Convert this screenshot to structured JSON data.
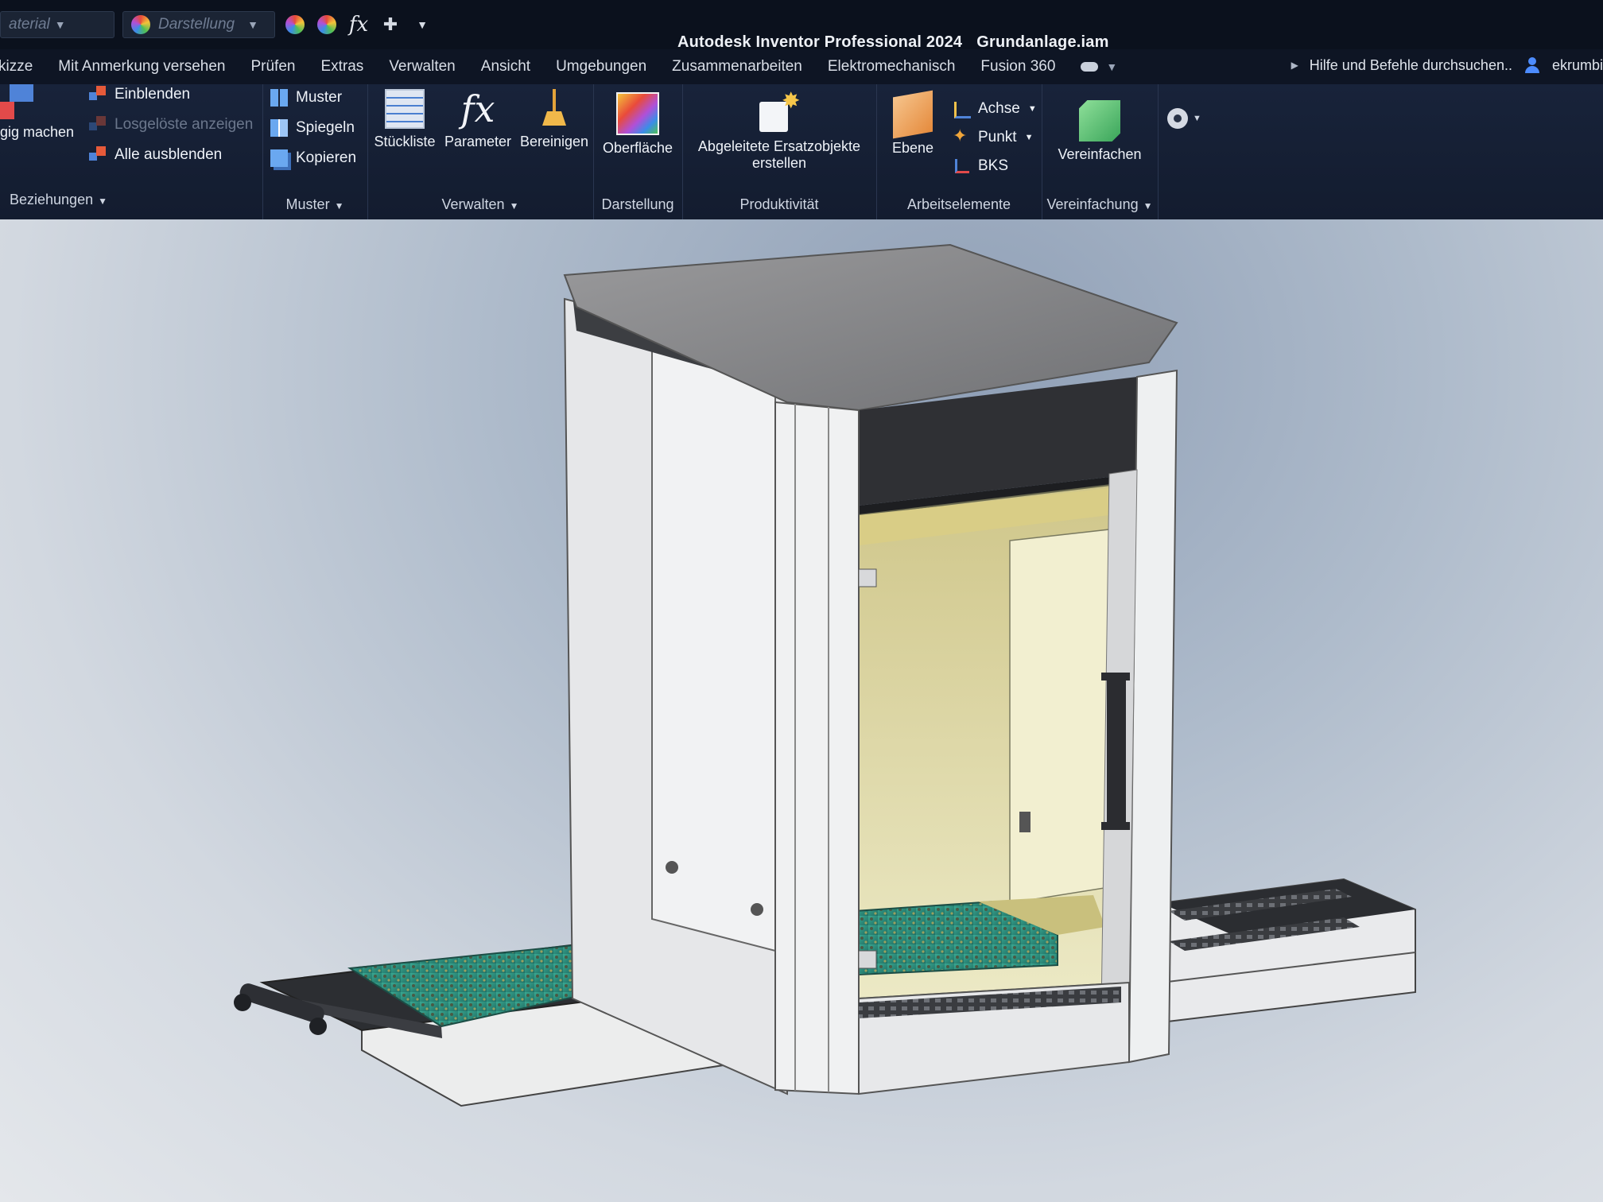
{
  "quick_access": {
    "material_placeholder": "aterial",
    "darstellung_placeholder": "Darstellung",
    "fx_label": "fx"
  },
  "title_bar": {
    "app_name": "Autodesk Inventor Professional 2024",
    "document": "Grundanlage.iam"
  },
  "help": {
    "search_label": "Hilfe und Befehle durchsuchen..",
    "user": "ekrumbi"
  },
  "tabs": [
    {
      "label": "kizze"
    },
    {
      "label": "Mit Anmerkung versehen"
    },
    {
      "label": "Prüfen"
    },
    {
      "label": "Extras"
    },
    {
      "label": "Verwalten"
    },
    {
      "label": "Ansicht"
    },
    {
      "label": "Umgebungen"
    },
    {
      "label": "Zusammenarbeiten"
    },
    {
      "label": "Elektromechanisch"
    },
    {
      "label": "Fusion 360"
    }
  ],
  "ribbon": {
    "beziehungen": {
      "label": "Beziehungen",
      "big_button": "gig machen",
      "einblenden": "Einblenden",
      "losgeloeste": "Losgelöste anzeigen",
      "alle_ausblenden": "Alle ausblenden"
    },
    "muster": {
      "label": "Muster",
      "muster": "Muster",
      "spiegeln": "Spiegeln",
      "kopieren": "Kopieren"
    },
    "verwalten": {
      "label": "Verwalten",
      "stueckliste": "Stückliste",
      "parameter": "Parameter",
      "bereinigen": "Bereinigen"
    },
    "darstellung": {
      "label": "Darstellung",
      "oberflaeche": "Oberfläche"
    },
    "produktivitaet": {
      "label": "Produktivität",
      "abgeleitete_line1": "Abgeleitete Ersatzobjekte",
      "abgeleitete_line2": "erstellen"
    },
    "arbeitselemente": {
      "label": "Arbeitselemente",
      "ebene": "Ebene",
      "achse": "Achse",
      "punkt": "Punkt",
      "bks": "BKS"
    },
    "vereinfachung": {
      "label": "Vereinfachung",
      "vereinfachen": "Vereinfachen"
    }
  },
  "colors": {
    "ribbon_bg": "#16213a",
    "title_bar_bg": "#0b111d",
    "viewport_top": "#8f9fb6",
    "viewport_bottom": "#e4e7eb",
    "interior_yellow": "#e6e3b0",
    "pcb_green": "#2f9a84"
  }
}
